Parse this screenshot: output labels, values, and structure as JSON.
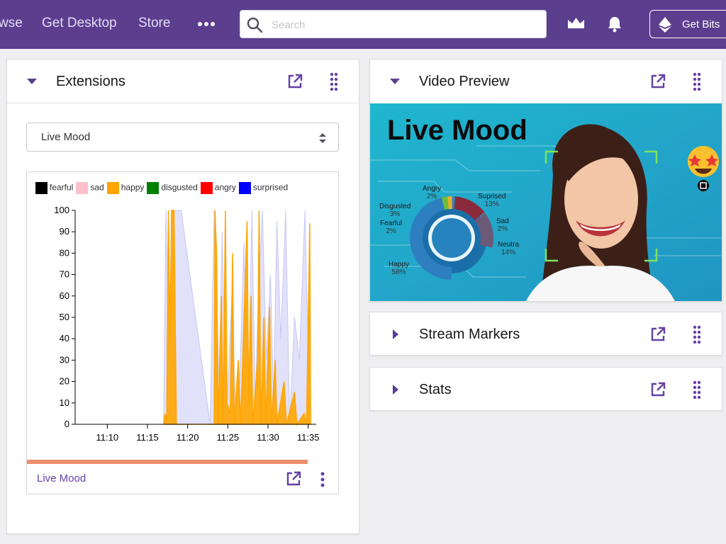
{
  "topbar": {
    "nav": [
      "wse",
      "Get Desktop",
      "Store"
    ],
    "search_placeholder": "Search",
    "get_bits_label": "Get Bits",
    "colors": {
      "background": "#5c3e8f",
      "accent": "#6441a5"
    },
    "icons": [
      "more-icon",
      "search-icon",
      "crown-icon",
      "bell-icon",
      "bits-icon"
    ]
  },
  "extensions_panel": {
    "title": "Extensions",
    "selected_extension": "Live Mood",
    "footer_label": "Live Mood",
    "progress_fraction": 0.9
  },
  "video_panel": {
    "title": "Video Preview",
    "image_title": "Live Mood",
    "donut_labels": [
      {
        "name": "Angry",
        "pct": "2%"
      },
      {
        "name": "Suprised",
        "pct": "13%"
      },
      {
        "name": "Disgusted",
        "pct": "3%"
      },
      {
        "name": "Fearful",
        "pct": "2%"
      },
      {
        "name": "Sad",
        "pct": "2%"
      },
      {
        "name": "Neutra",
        "pct": "14%"
      },
      {
        "name": "Happy",
        "pct": "58%"
      }
    ]
  },
  "stream_markers_panel": {
    "title": "Stream Markers"
  },
  "stats_panel": {
    "title": "Stats"
  },
  "chart_data": {
    "type": "area",
    "legend": [
      {
        "name": "fearful",
        "color": "#000000"
      },
      {
        "name": "sad",
        "color": "#ffc0cb"
      },
      {
        "name": "happy",
        "color": "#ffa500"
      },
      {
        "name": "disgusted",
        "color": "#008000"
      },
      {
        "name": "angry",
        "color": "#ff0000"
      },
      {
        "name": "surprised",
        "color": "#0000ff"
      }
    ],
    "x_ticks": [
      "11:10",
      "11:15",
      "11:20",
      "11:25",
      "11:30",
      "11:35"
    ],
    "y_ticks": [
      0,
      10,
      20,
      30,
      40,
      50,
      60,
      70,
      80,
      90,
      100
    ],
    "ylim": [
      0,
      100
    ],
    "xlim": [
      "11:06",
      "11:36"
    ],
    "series": [
      {
        "name": "happy",
        "color": "#ffa500",
        "points": [
          [
            "11:17.0",
            0
          ],
          [
            "11:17.2",
            5
          ],
          [
            "11:17.4",
            2
          ],
          [
            "11:17.6",
            100
          ],
          [
            "11:17.8",
            40
          ],
          [
            "11:18.0",
            100
          ],
          [
            "11:18.3",
            100
          ],
          [
            "11:18.6",
            0
          ],
          [
            "11:19.0",
            0
          ],
          [
            "11:23.3",
            0
          ],
          [
            "11:23.4",
            100
          ],
          [
            "11:23.6",
            80
          ],
          [
            "11:23.8",
            0
          ],
          [
            "11:24.2",
            60
          ],
          [
            "11:24.4",
            0
          ],
          [
            "11:24.7",
            100
          ],
          [
            "11:24.9",
            10
          ],
          [
            "11:25.3",
            5
          ],
          [
            "11:25.6",
            80
          ],
          [
            "11:25.8",
            0
          ],
          [
            "11:26.3",
            30
          ],
          [
            "11:26.6",
            0
          ],
          [
            "11:27.4",
            95
          ],
          [
            "11:27.6",
            10
          ],
          [
            "11:27.9",
            60
          ],
          [
            "11:28.1",
            0
          ],
          [
            "11:28.7",
            30
          ],
          [
            "11:28.9",
            100
          ],
          [
            "11:29.1",
            0
          ],
          [
            "11:29.5",
            50
          ],
          [
            "11:29.7",
            0
          ],
          [
            "11:30.2",
            55
          ],
          [
            "11:30.4",
            0
          ],
          [
            "11:30.9",
            30
          ],
          [
            "11:31.1",
            0
          ],
          [
            "11:32.0",
            20
          ],
          [
            "11:32.3",
            0
          ],
          [
            "11:33.3",
            15
          ],
          [
            "11:33.6",
            0
          ],
          [
            "11:34.5",
            5
          ],
          [
            "11:34.8",
            0
          ],
          [
            "11:35.2",
            94
          ],
          [
            "11:35.3",
            0
          ]
        ]
      },
      {
        "name": "surprised",
        "color": "#c8c8f5",
        "points": [
          [
            "11:17.0",
            0
          ],
          [
            "11:17.3",
            100
          ],
          [
            "11:17.7",
            30
          ],
          [
            "11:18.0",
            100
          ],
          [
            "11:19.2",
            100
          ],
          [
            "11:22.8",
            0
          ],
          [
            "11:23.3",
            100
          ],
          [
            "11:23.9",
            20
          ],
          [
            "11:24.3",
            90
          ],
          [
            "11:24.8",
            0
          ],
          [
            "11:25.5",
            60
          ],
          [
            "11:26.0",
            0
          ],
          [
            "11:26.4",
            10
          ],
          [
            "11:27.0",
            85
          ],
          [
            "11:27.5",
            0
          ],
          [
            "11:28.0",
            100
          ],
          [
            "11:28.4",
            10
          ],
          [
            "11:28.8",
            60
          ],
          [
            "11:29.3",
            100
          ],
          [
            "11:29.8",
            30
          ],
          [
            "11:30.3",
            70
          ],
          [
            "11:30.7",
            10
          ],
          [
            "11:31.1",
            95
          ],
          [
            "11:31.6",
            40
          ],
          [
            "11:32.2",
            100
          ],
          [
            "11:32.7",
            0
          ],
          [
            "11:33.3",
            50
          ],
          [
            "11:33.9",
            30
          ],
          [
            "11:34.6",
            100
          ],
          [
            "11:35.2",
            0
          ]
        ]
      }
    ]
  }
}
